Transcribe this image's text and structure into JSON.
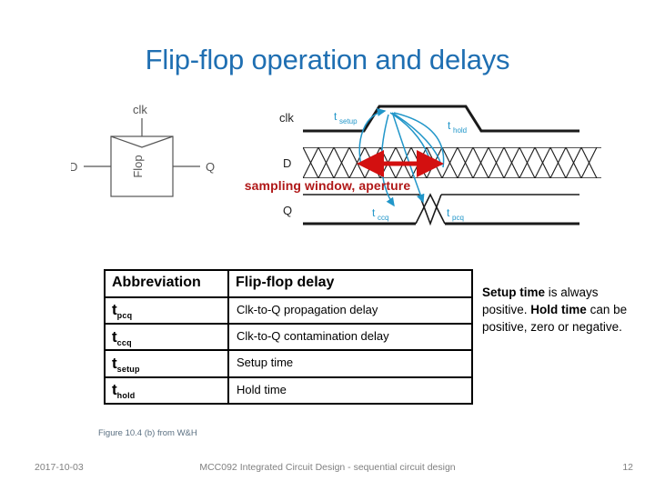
{
  "slide": {
    "title": "Flip-flop operation and delays"
  },
  "figure_symbol": {
    "clk_label": "clk",
    "d_label": "D",
    "q_label": "Q",
    "box_label": "Flop"
  },
  "timing_diagram": {
    "signals": [
      "clk",
      "D",
      "Q"
    ],
    "annotations": {
      "t_setup": "t",
      "t_setup_sub": "setup",
      "t_hold": "t",
      "t_hold_sub": "hold",
      "t_ccq": "t",
      "t_ccq_sub": "ccq",
      "t_pcq": "t",
      "t_pcq_sub": "pcq"
    },
    "overlay_label": "sampling window, aperture",
    "overlay_color": "#B01818",
    "annotation_color": "#2196C9"
  },
  "table": {
    "headers": [
      "Abbreviation",
      "Flip-flop delay"
    ],
    "rows": [
      {
        "abbr_base": "t",
        "abbr_sub": "pcq",
        "description": "Clk-to-Q propagation delay"
      },
      {
        "abbr_base": "t",
        "abbr_sub": "ccq",
        "description": "Clk-to-Q contamination delay"
      },
      {
        "abbr_base": "t",
        "abbr_sub": "setup",
        "description": "Setup time"
      },
      {
        "abbr_base": "t",
        "abbr_sub": "hold",
        "description": "Hold time"
      }
    ]
  },
  "side_note": {
    "line1_bold": "Setup time",
    "line1_rest": " is always positive.",
    "line2_bold": "Hold time",
    "line2_rest": " can be positive, zero or negative."
  },
  "caption": {
    "text": "Figure 10.4 (b) from W&H"
  },
  "footer": {
    "date": "2017-10-03",
    "center": "MCC092 Integrated Circuit Design - sequential circuit design",
    "page": "12"
  },
  "colors": {
    "title_blue": "#1F6FB2",
    "annotation_blue": "#2196C9",
    "overlay_red": "#B01818",
    "footer_gray": "#808080"
  }
}
